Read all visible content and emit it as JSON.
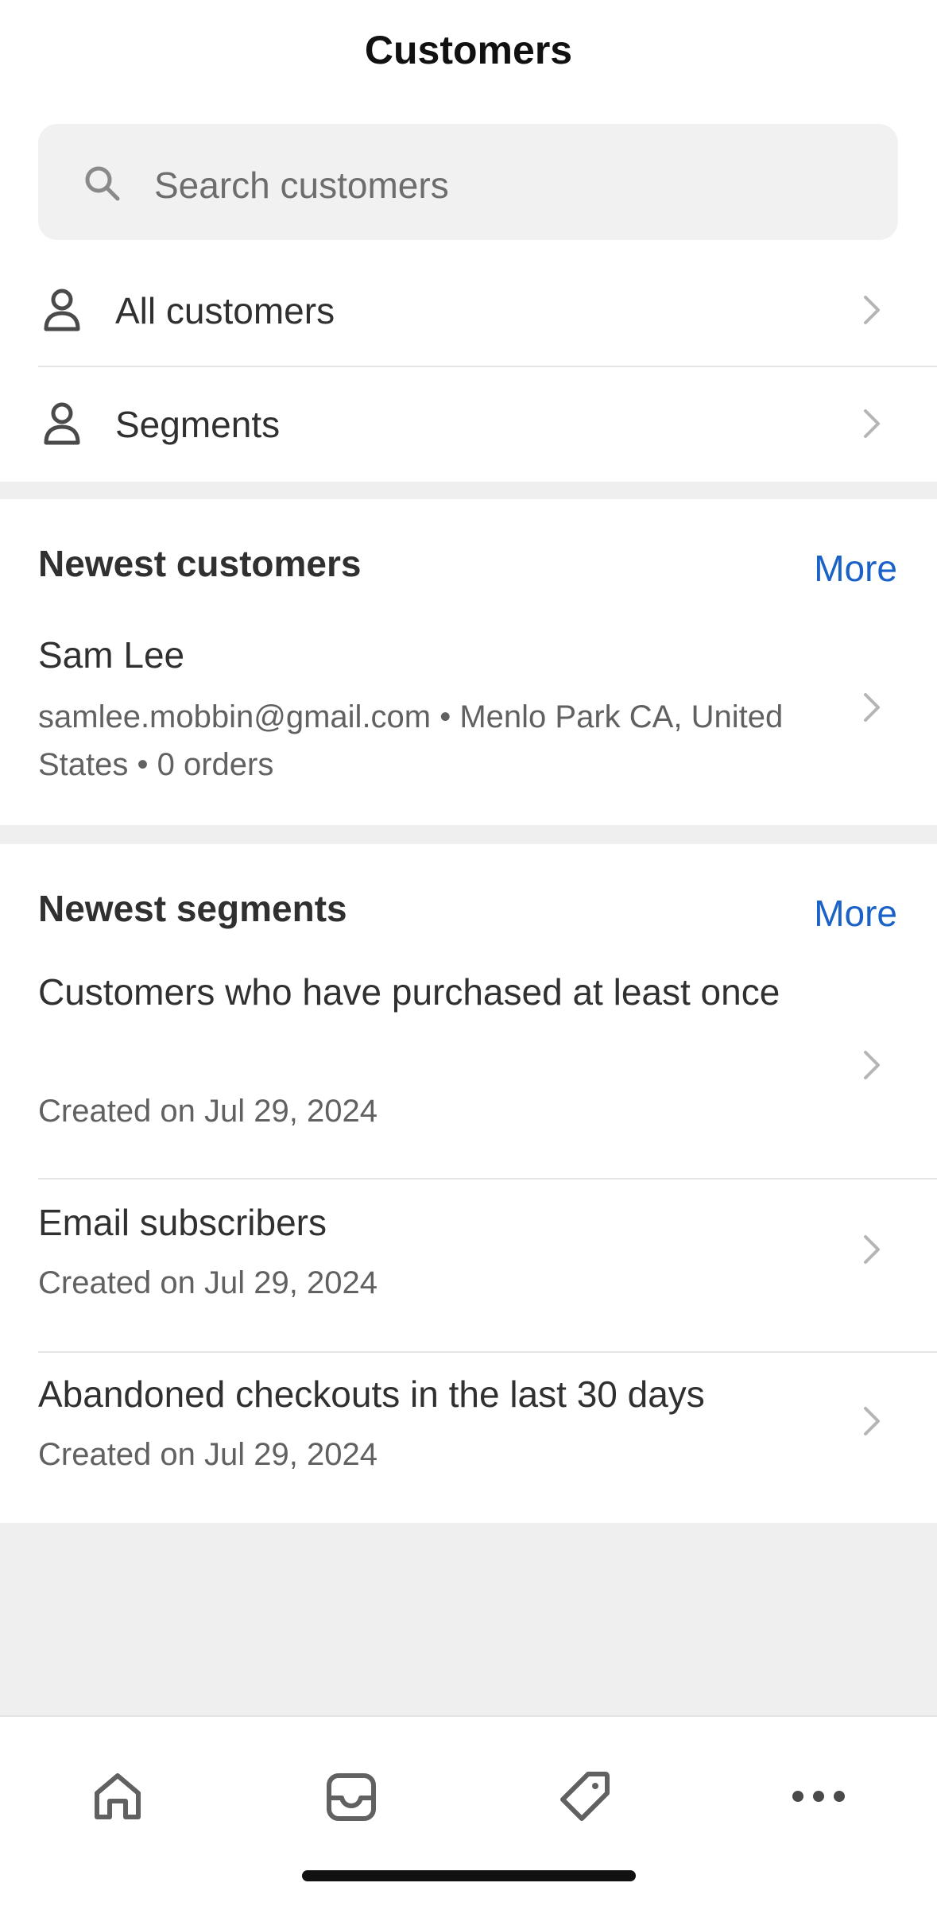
{
  "header": {
    "title": "Customers"
  },
  "search": {
    "placeholder": "Search customers"
  },
  "nav": [
    {
      "label": "All customers",
      "icon": "person-icon"
    },
    {
      "label": "Segments",
      "icon": "person-icon"
    }
  ],
  "newest_customers": {
    "title": "Newest customers",
    "more_label": "More",
    "items": [
      {
        "name": "Sam Lee",
        "details": "samlee.mobbin@gmail.com • Menlo Park CA, United States • 0 orders"
      }
    ]
  },
  "newest_segments": {
    "title": "Newest segments",
    "more_label": "More",
    "items": [
      {
        "name": "Customers who have purchased at least once",
        "created": "Created on Jul 29, 2024"
      },
      {
        "name": "Email subscribers",
        "created": "Created on Jul 29, 2024"
      },
      {
        "name": "Abandoned checkouts in the last 30 days",
        "created": "Created on Jul 29, 2024"
      }
    ]
  },
  "tabbar": {
    "tabs": [
      {
        "icon": "home-icon"
      },
      {
        "icon": "inbox-icon"
      },
      {
        "icon": "tag-icon"
      },
      {
        "icon": "more-dots-icon"
      }
    ]
  },
  "colors": {
    "accent": "#1a61c8",
    "background": "#efefef",
    "text": "#303030"
  }
}
